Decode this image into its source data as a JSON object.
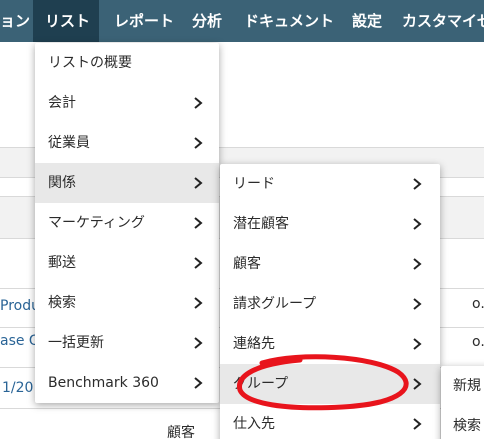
{
  "topnav": {
    "items": [
      {
        "label": "ョン"
      },
      {
        "label": "リスト"
      },
      {
        "label": "レポート"
      },
      {
        "label": "分析"
      },
      {
        "label": "ドキュメント"
      },
      {
        "label": "設定"
      },
      {
        "label": "カスタマイゼ"
      }
    ]
  },
  "background": {
    "texts": [
      "Produ",
      "ase G",
      "1/20",
      "顧客",
      "o.",
      "o."
    ]
  },
  "menu_list": {
    "items": [
      {
        "label": "リストの概要"
      },
      {
        "label": "会計"
      },
      {
        "label": "従業員"
      },
      {
        "label": "関係"
      },
      {
        "label": "マーケティング"
      },
      {
        "label": "郵送"
      },
      {
        "label": "検索"
      },
      {
        "label": "一括更新"
      },
      {
        "label": "Benchmark 360"
      }
    ]
  },
  "menu_relations": {
    "items": [
      {
        "label": "リード"
      },
      {
        "label": "潜在顧客"
      },
      {
        "label": "顧客"
      },
      {
        "label": "請求グループ"
      },
      {
        "label": "連絡先"
      },
      {
        "label": "グループ"
      },
      {
        "label": "仕入先"
      }
    ]
  },
  "menu_group": {
    "items": [
      {
        "label": "新規"
      },
      {
        "label": "検索"
      }
    ]
  },
  "colors": {
    "nav_bg": "#3b6276",
    "nav_active": "#1f3f50",
    "highlight": "#e8e8e8",
    "annotation": "#e8141c"
  }
}
